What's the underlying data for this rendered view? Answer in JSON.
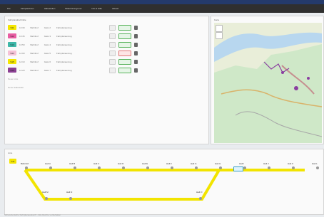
{
  "menu": [
    "File",
    "Fahrplanlinien",
    "Haltestellen",
    "Bilderhintergrund",
    "Info & Hilfe",
    "Aktuell"
  ],
  "left_panel": {
    "title": "Fahrplanabschnitte",
    "rows": [
      {
        "badge": "S11",
        "color": "#f4e600",
        "a": "13:30",
        "b": "Bahnhof",
        "c": "Gleis 2",
        "d": "Fahrplanauszug"
      },
      {
        "badge": "S12",
        "color": "#e85ca2",
        "a": "13:45",
        "b": "Bahnhof",
        "c": "Gleis 3",
        "d": "Fahrplanauszug"
      },
      {
        "badge": "S13",
        "color": "#3db7a8",
        "a": "13:50",
        "b": "Bahnhof",
        "c": "Gleis 4",
        "d": "Fahrplanauszug"
      },
      {
        "badge": "S14",
        "color": "#f5c2d6",
        "a": "14:00",
        "b": "Bahnhof",
        "c": "Gleis 5",
        "d": "Fahrplanauszug"
      },
      {
        "badge": "S15",
        "color": "#f4e600",
        "a": "14:10",
        "b": "Bahnhof",
        "c": "Gleis 6",
        "d": "Fahrplanauszug"
      },
      {
        "badge": "S16",
        "color": "#8b3f93",
        "a": "14:20",
        "b": "Bahnhof",
        "c": "Gleis 7",
        "d": "Fahrplanauszug"
      }
    ],
    "muted_rows": [
      "Neue Linie",
      "Neue Haltestelle"
    ]
  },
  "map": {
    "title": "Karte"
  },
  "route": {
    "title": "Linie",
    "badge": "S11",
    "top_stops": [
      "Bahnhof",
      "Halt A",
      "Halt B",
      "Halt C",
      "Halt D",
      "Halt E",
      "Halt F",
      "Halt G",
      "Halt H",
      "Halt I",
      "Halt J",
      "Halt K",
      "Halt L"
    ],
    "bottom_stops": [
      "Halt M",
      "Halt N",
      "Halt O"
    ]
  },
  "footer": "Schweizerische Fahrplanauskunft - Alle Rechte vorbehalten"
}
